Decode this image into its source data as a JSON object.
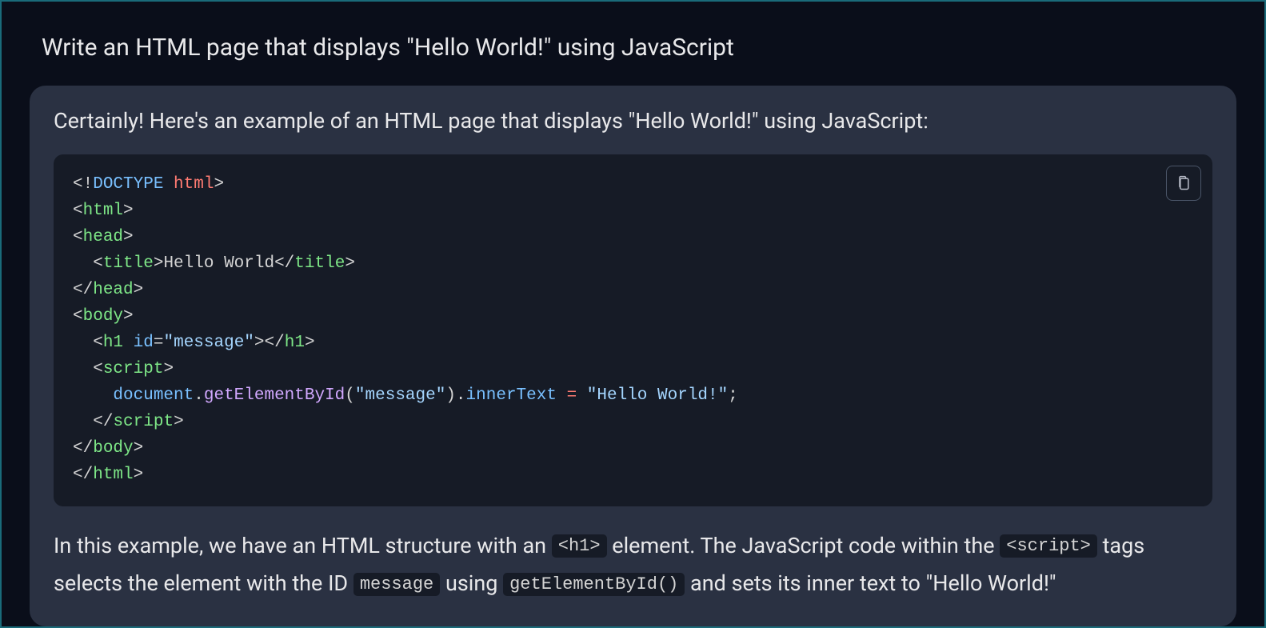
{
  "prompt": "Write an HTML page that displays \"Hello World!\" using JavaScript",
  "response": {
    "intro": "Certainly! Here's an example of an HTML page that displays \"Hello World!\" using JavaScript:",
    "code": {
      "doctype_kw": "DOCTYPE",
      "doctype_val": "html",
      "tag_html": "html",
      "tag_head": "head",
      "tag_title": "title",
      "title_text": "Hello World",
      "tag_body": "body",
      "tag_h1": "h1",
      "attr_id": "id",
      "id_value": "\"message\"",
      "tag_script": "script",
      "js_document": "document",
      "js_getElementById": "getElementById",
      "js_arg": "\"message\"",
      "js_innerText": "innerText",
      "js_assign": "=",
      "js_string": "\"Hello World!\"",
      "js_semi": ";"
    },
    "explanation": {
      "part1": "In this example, we have an HTML structure with an ",
      "inline1": "<h1>",
      "part2": " element. The JavaScript code within the ",
      "inline2": "<script>",
      "part3": " tags selects the element with the ID ",
      "inline3": "message",
      "part4": " using ",
      "inline4": "getElementById()",
      "part5": " and sets its inner text to \"Hello World!\""
    }
  },
  "icons": {
    "copy": "clipboard-icon"
  }
}
